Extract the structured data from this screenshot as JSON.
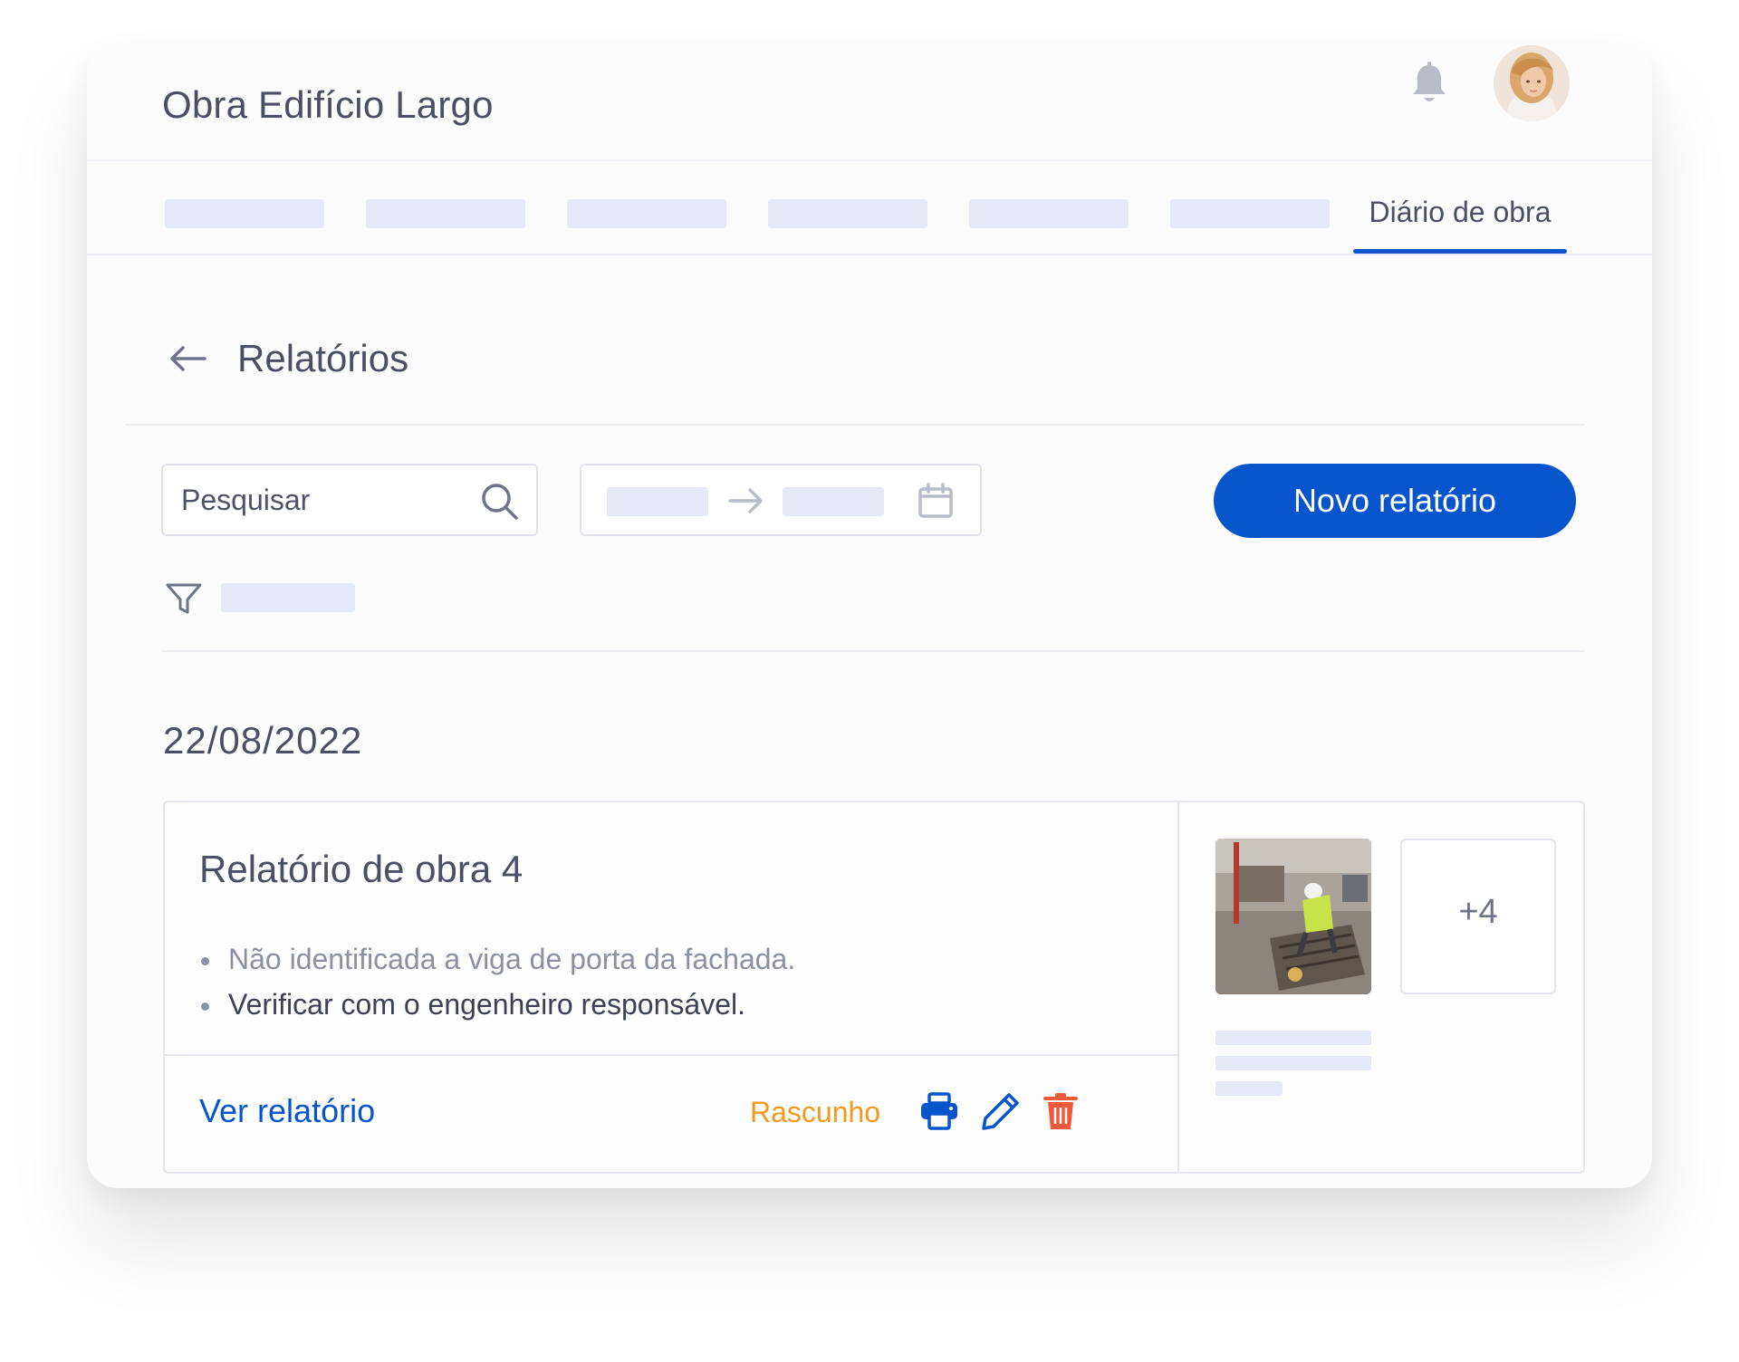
{
  "header": {
    "title": "Obra Edifício Largo",
    "bell_icon": "bell-icon",
    "avatar_icon": "user-avatar"
  },
  "tabs": {
    "active_label": "Diário de obra"
  },
  "page": {
    "title": "Relatórios",
    "back_icon": "arrow-left-icon"
  },
  "toolbar": {
    "search_placeholder": "Pesquisar",
    "search_icon": "search-icon",
    "date_arrow_icon": "arrow-right-icon",
    "calendar_icon": "calendar-icon",
    "new_report_label": "Novo relatório",
    "filter_icon": "filter-icon"
  },
  "group": {
    "date": "22/08/2022"
  },
  "report": {
    "title": "Relatório de obra 4",
    "notes": [
      "Não identificada a viga de porta da fachada.",
      "Verificar com o engenheiro responsável."
    ],
    "view_label": "Ver relatório",
    "status": "Rascunho",
    "more_photos": "+4",
    "actions": [
      "printer-icon",
      "pencil-icon",
      "trash-icon"
    ]
  },
  "colors": {
    "accent": "#0755cc",
    "status_draft": "#f39a1c",
    "danger": "#ef5a3c",
    "text": "#4a4f63",
    "placeholder": "#e4e8f8"
  }
}
